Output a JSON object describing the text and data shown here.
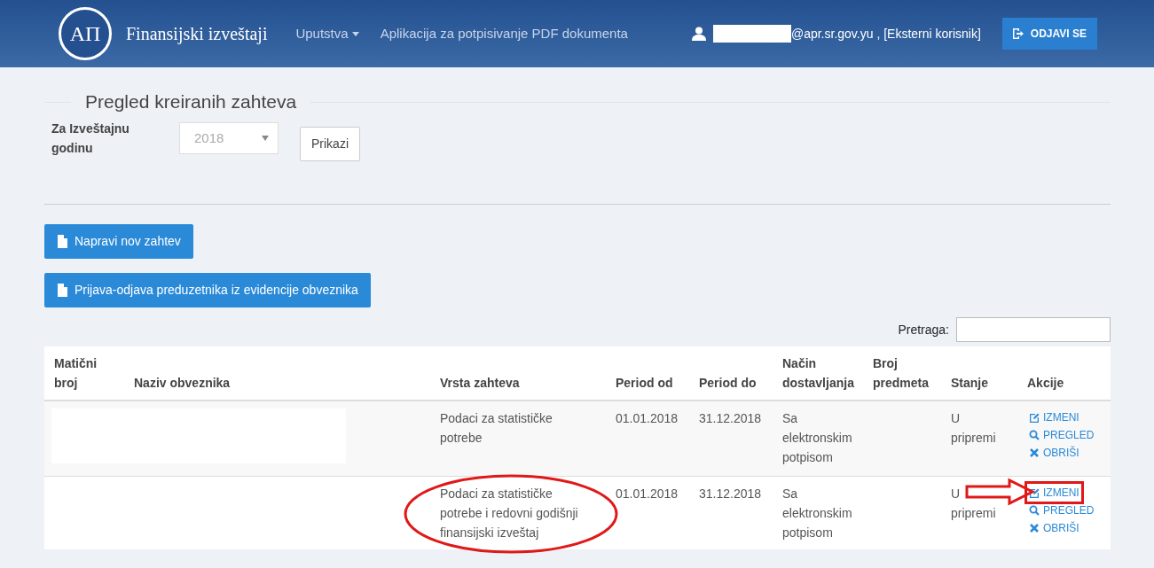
{
  "navbar": {
    "brand_logo": "AП",
    "brand": "Finansijski izveštaji",
    "links": [
      {
        "label": "Uputstva",
        "dropdown": true
      },
      {
        "label": "Aplikacija za potpisivanje PDF dokumenta",
        "dropdown": false
      }
    ],
    "user_suffix": "@apr.sr.gov.yu , [Eksterni korisnik]",
    "logout": "ODJAVI SE"
  },
  "section_title": "Pregled kreiranih zahteva",
  "filter": {
    "label": "Za Izveštajnu godinu",
    "year": "2018",
    "button": "Prikazi"
  },
  "action_buttons": [
    "Napravi nov zahtev",
    "Prijava-odjava preduzetnika iz evidencije obveznika"
  ],
  "search": {
    "label": "Pretraga:"
  },
  "table": {
    "columns": [
      "Matični broj",
      "Naziv obveznika",
      "Vrsta zahteva",
      "Period od",
      "Period do",
      "Način dostavljanja",
      "Broj predmeta",
      "Stanje",
      "Akcije"
    ],
    "rows": [
      {
        "redacted": true,
        "circled": false,
        "arrow": false,
        "cells": [
          "",
          "",
          "Podaci za statističke potrebe",
          "01.01.2018",
          "31.12.2018",
          "Sa elektronskim potpisom",
          "",
          "U pripremi"
        ],
        "actions": [
          {
            "kind": "edit",
            "label": "IZMENI",
            "boxed": false
          },
          {
            "kind": "view",
            "label": "PREGLED",
            "boxed": false
          },
          {
            "kind": "delete",
            "label": "OBRIŠI",
            "boxed": false
          }
        ]
      },
      {
        "redacted": false,
        "circled": true,
        "arrow": true,
        "cells": [
          "",
          "",
          "Podaci za statističke potrebe i redovni godišnji finansijski izveštaj",
          "01.01.2018",
          "31.12.2018",
          "Sa elektronskim potpisom",
          "",
          "U pripremi"
        ],
        "actions": [
          {
            "kind": "edit",
            "label": "IZMENI",
            "boxed": true
          },
          {
            "kind": "view",
            "label": "PREGLED",
            "boxed": false
          },
          {
            "kind": "delete",
            "label": "OBRIŠI",
            "boxed": false
          }
        ]
      }
    ]
  }
}
